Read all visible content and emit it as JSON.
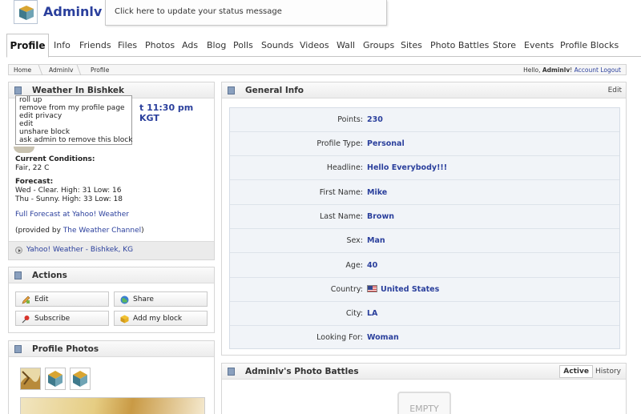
{
  "header": {
    "site_name": "Adminlv",
    "status_placeholder": "Click here to update your status message"
  },
  "tabs": [
    "Profile",
    "Info",
    "Friends",
    "Files",
    "Photos",
    "Ads",
    "Blog",
    "Polls",
    "Sounds",
    "Videos",
    "Wall",
    "Groups",
    "Sites",
    "Photo Battles",
    "Store",
    "Events",
    "Profile Blocks"
  ],
  "breadcrumb": {
    "items": [
      "Home",
      "Adminlv",
      "Profile"
    ],
    "greeting": "Hello,",
    "user": "Adminlv",
    "exclaim": "!",
    "account": "Account",
    "logout": "Logout"
  },
  "weather": {
    "title": "Weather In Bishkek",
    "time": "t 11:30 pm KGT",
    "menu": [
      "roll up",
      "remove from my profile page",
      "edit privacy",
      "edit",
      "unshare block",
      "ask admin to remove this block"
    ],
    "conditions_label": "Current Conditions:",
    "conditions": "Fair, 22 C",
    "forecast_label": "Forecast:",
    "forecast": [
      "Wed - Clear. High: 31 Low: 16",
      "Thu - Sunny. High: 33 Low: 18"
    ],
    "full_link": "Full Forecast at Yahoo! Weather",
    "provided_prefix": "(provided by",
    "provider": "The Weather Channel",
    "provided_suffix": ")",
    "footer_link": "Yahoo! Weather - Bishkek, KG"
  },
  "actions": {
    "title": "Actions",
    "buttons": [
      "Edit",
      "Share",
      "Subscribe",
      "Add my block"
    ]
  },
  "photos": {
    "title": "Profile Photos"
  },
  "general_info": {
    "title": "General Info",
    "edit": "Edit",
    "rows": [
      {
        "label": "Points:",
        "value": "230"
      },
      {
        "label": "Profile Type:",
        "value": "Personal"
      },
      {
        "label": "Headline:",
        "value": "Hello Everybody!!!"
      },
      {
        "label": "First Name:",
        "value": "Mike"
      },
      {
        "label": "Last Name:",
        "value": "Brown"
      },
      {
        "label": "Sex:",
        "value": "Man"
      },
      {
        "label": "Age:",
        "value": "40"
      },
      {
        "label": "Country:",
        "value": "United States"
      },
      {
        "label": "City:",
        "value": "LA"
      },
      {
        "label": "Looking For:",
        "value": "Woman"
      }
    ]
  },
  "battles": {
    "title": "Adminlv's Photo Battles",
    "tab_active": "Active",
    "tab_history": "History",
    "empty": "EMPTY"
  }
}
